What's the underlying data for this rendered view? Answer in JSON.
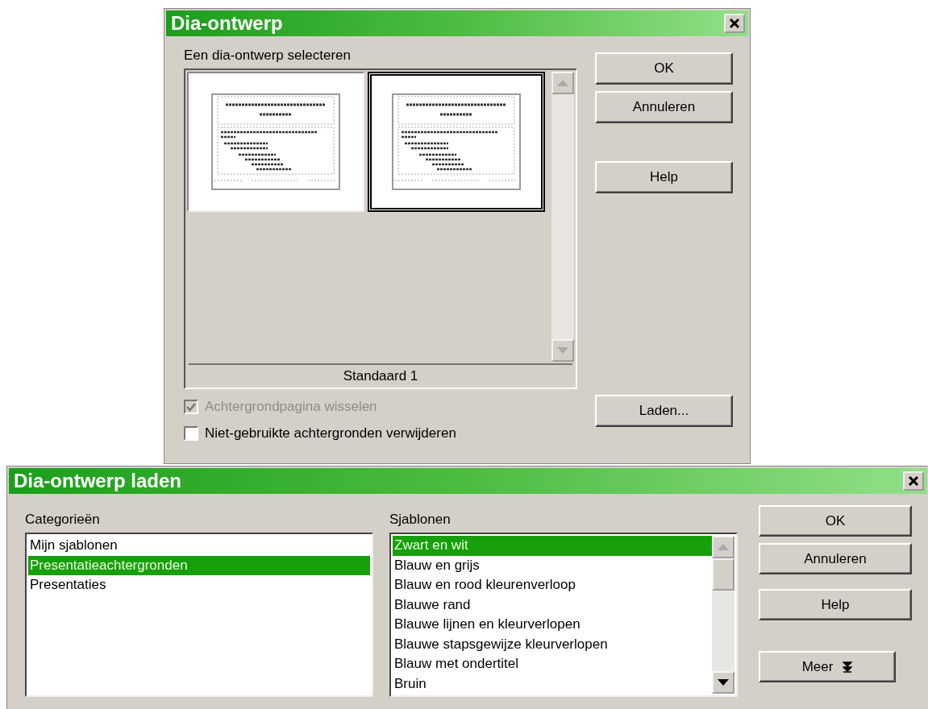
{
  "design_dialog": {
    "title": "Dia-ontwerp",
    "label": "Een dia-ontwerp selecteren",
    "thumbnails": [
      {
        "selected": false
      },
      {
        "selected": true
      }
    ],
    "caption": "Standaard 1",
    "checkboxes": [
      {
        "label": "Achtergrondpagina wisselen",
        "checked": true,
        "disabled": true
      },
      {
        "label": "Niet-gebruikte achtergronden verwijderen",
        "checked": false,
        "disabled": false
      }
    ],
    "buttons": [
      {
        "label": "OK"
      },
      {
        "label": "Annuleren"
      },
      {
        "label": "Help"
      },
      {
        "label": "Laden..."
      }
    ]
  },
  "load_dialog": {
    "title": "Dia-ontwerp laden",
    "categories_label": "Categorieën",
    "categories": [
      {
        "label": "Mijn sjablonen",
        "selected": false
      },
      {
        "label": "Presentatieachtergronden",
        "selected": true
      },
      {
        "label": "Presentaties",
        "selected": false
      }
    ],
    "templates_label": "Sjablonen",
    "templates": [
      {
        "label": "Zwart en wit",
        "selected": true
      },
      {
        "label": "Blauw en grijs",
        "selected": false
      },
      {
        "label": "Blauw en rood kleurenverloop",
        "selected": false
      },
      {
        "label": "Blauwe rand",
        "selected": false
      },
      {
        "label": "Blauwe lijnen en kleurverlopen",
        "selected": false
      },
      {
        "label": "Blauwe stapsgewijze kleurverlopen",
        "selected": false
      },
      {
        "label": "Blauw met ondertitel",
        "selected": false
      },
      {
        "label": "Bruin",
        "selected": false
      }
    ],
    "buttons": [
      {
        "label": "OK"
      },
      {
        "label": "Annuleren"
      },
      {
        "label": "Help"
      },
      {
        "label": "Meer",
        "kind": "expand"
      }
    ]
  }
}
